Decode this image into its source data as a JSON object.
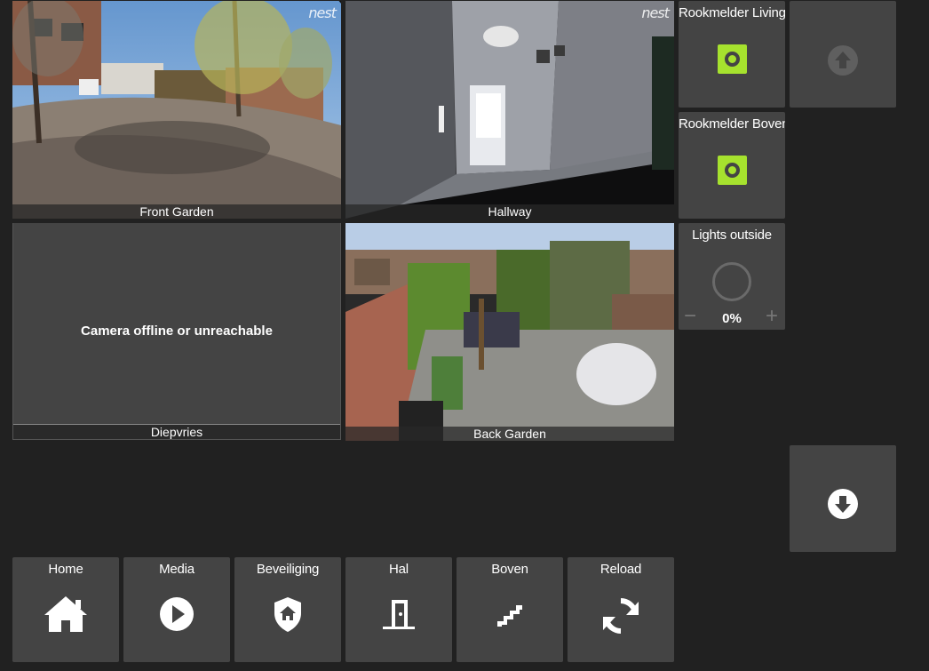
{
  "cameras": {
    "front_garden": {
      "label": "Front Garden",
      "brand": "nest"
    },
    "hallway": {
      "label": "Hallway",
      "brand": "nest"
    },
    "diepvries": {
      "label": "Diepvries",
      "status": "Camera offline or unreachable"
    },
    "back_garden": {
      "label": "Back Garden"
    }
  },
  "sensors": {
    "rookmelder_living": {
      "title": "Rookmelder Living",
      "state_color": "#a6e22e"
    },
    "rookmelder_boven": {
      "title": "Rookmelder Boven",
      "state_color": "#a6e22e"
    }
  },
  "lights_outside": {
    "title": "Lights outside",
    "value": "0%",
    "minus": "−",
    "plus": "+"
  },
  "paging": {
    "up_icon": "arrow-up-circle-icon",
    "down_icon": "arrow-down-circle-icon"
  },
  "nav": [
    {
      "label": "Home",
      "icon": "home-icon"
    },
    {
      "label": "Media",
      "icon": "play-circle-icon"
    },
    {
      "label": "Beveiliging",
      "icon": "shield-home-icon"
    },
    {
      "label": "Hal",
      "icon": "door-icon"
    },
    {
      "label": "Boven",
      "icon": "stairs-icon"
    },
    {
      "label": "Reload",
      "icon": "refresh-icon"
    }
  ],
  "colors": {
    "background": "#212121",
    "tile": "#444444",
    "accent": "#a6e22e"
  }
}
